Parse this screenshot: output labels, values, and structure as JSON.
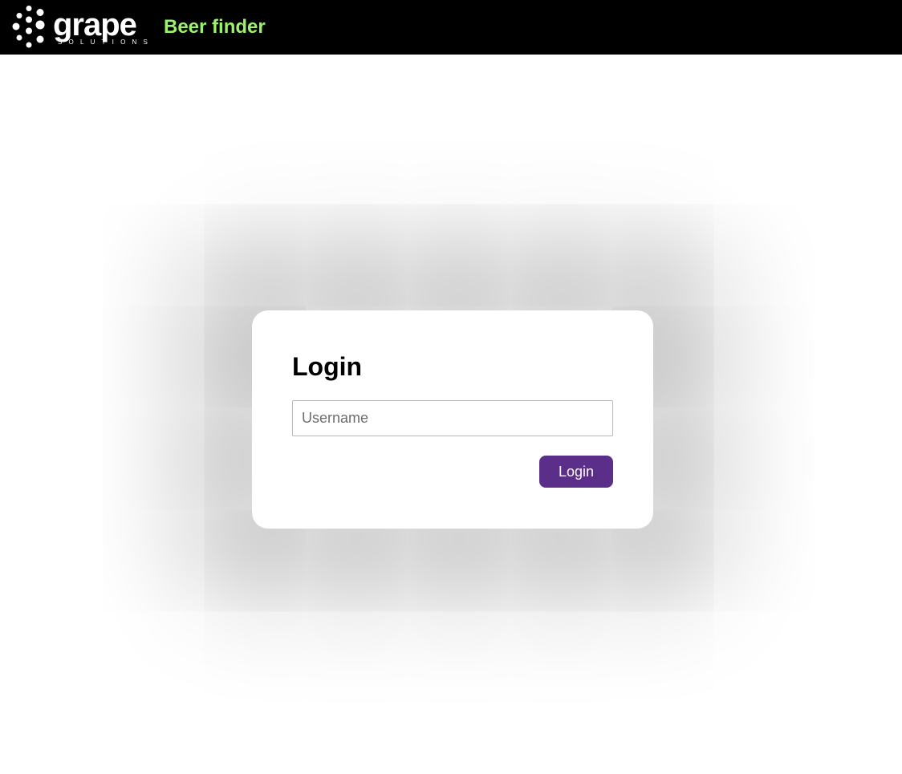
{
  "header": {
    "logo": {
      "icon": "grape-solutions-logo",
      "wordmark": "grape",
      "tagline": "SOLUTIONS"
    },
    "app_title": "Beer finder",
    "colors": {
      "background": "#000000",
      "app_title": "#9cf26a"
    }
  },
  "login": {
    "title": "Login",
    "username": {
      "placeholder": "Username",
      "value": ""
    },
    "submit_label": "Login",
    "colors": {
      "button": "#5b2e8a"
    }
  }
}
